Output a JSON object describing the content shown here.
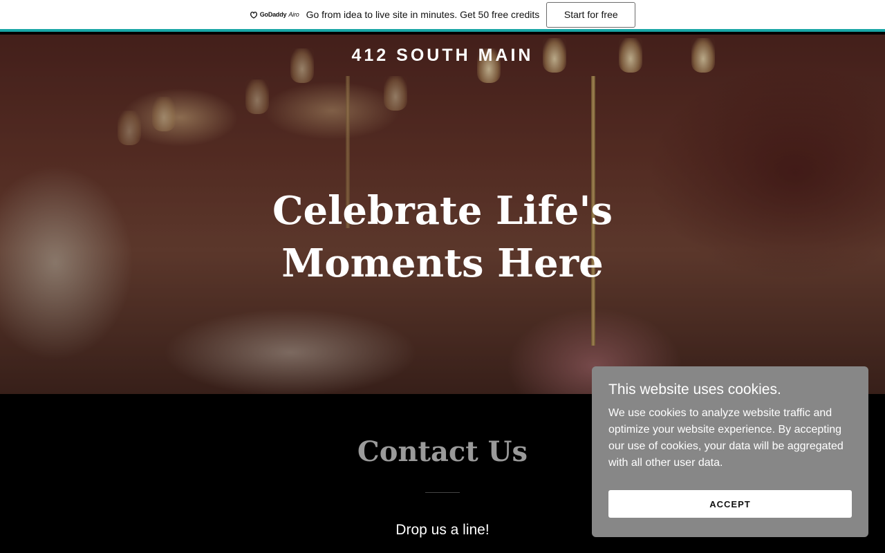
{
  "promo": {
    "logo_brand": "GoDaddy",
    "logo_product": "Airo",
    "text": "Go from idea to live site in minutes. Get 50 free credits",
    "button_label": "Start for free",
    "accent_color": "#1aa6a6"
  },
  "hero": {
    "site_name": "412 SOUTH MAIN",
    "title": "Celebrate Life's Moments Here"
  },
  "contact": {
    "title": "Contact Us",
    "subtitle": "Drop us a line!"
  },
  "cookie_banner": {
    "title": "This website uses cookies.",
    "text": "We use cookies to analyze website traffic and optimize your website experience. By accepting our use of cookies, your data will be aggregated with all other user data.",
    "accept_label": "ACCEPT"
  }
}
